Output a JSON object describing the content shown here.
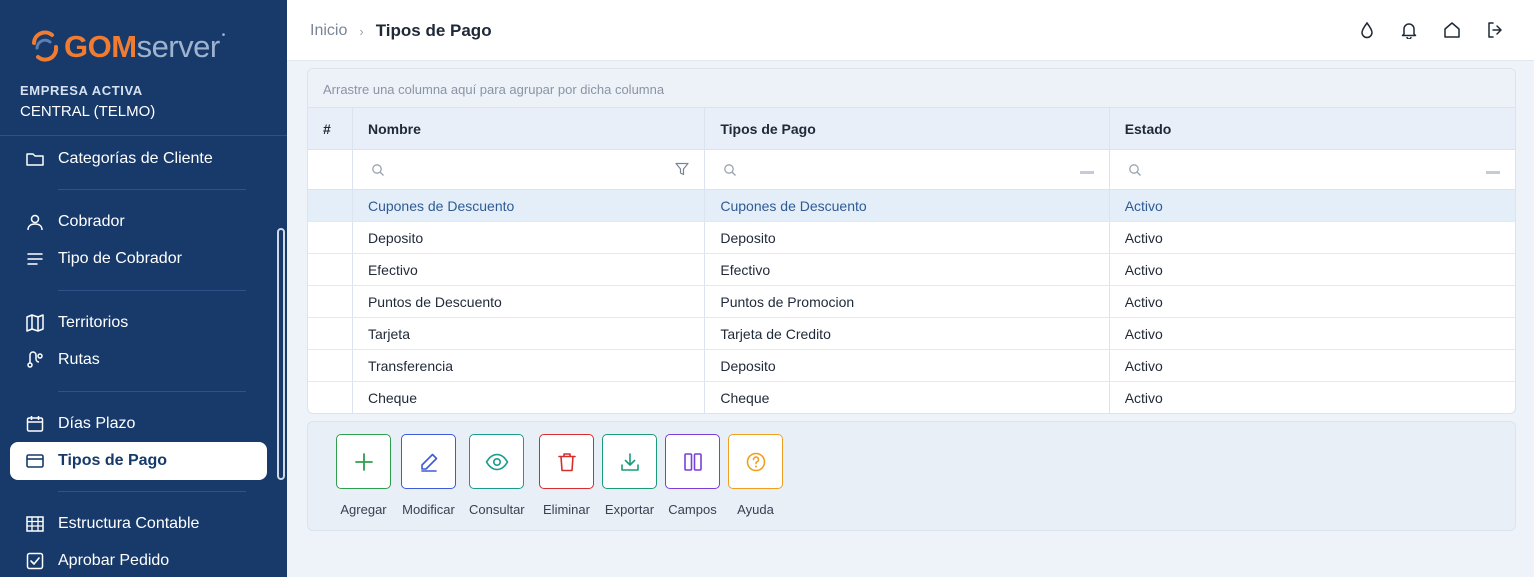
{
  "brand": {
    "gom": "GOM",
    "server": "server",
    "mark": "•"
  },
  "company": {
    "label": "EMPRESA ACTIVA",
    "name": "CENTRAL (TELMO)"
  },
  "sidebar": {
    "items": [
      {
        "label": "Categorías de Cliente",
        "icon": "folder-icon"
      },
      {
        "label": "Cobrador",
        "icon": "user-icon"
      },
      {
        "label": "Tipo de Cobrador",
        "icon": "list-icon"
      },
      {
        "label": "Territorios",
        "icon": "map-icon"
      },
      {
        "label": "Rutas",
        "icon": "route-icon"
      },
      {
        "label": "Días Plazo",
        "icon": "calendar-icon"
      },
      {
        "label": "Tipos de Pago",
        "icon": "credit-card-icon",
        "active": true
      },
      {
        "label": "Estructura Contable",
        "icon": "table-icon"
      },
      {
        "label": "Aprobar Pedido",
        "icon": "check-square-icon"
      }
    ]
  },
  "breadcrumb": {
    "home": "Inicio",
    "separator": "›",
    "current": "Tipos de Pago"
  },
  "header_icons": [
    "theme-drop-icon",
    "bell-icon",
    "home-icon",
    "logout-icon"
  ],
  "grid": {
    "group_hint": "Arrastre una columna aquí para agrupar por dicha columna",
    "columns": [
      "#",
      "Nombre",
      "Tipos de Pago",
      "Estado"
    ],
    "rows": [
      {
        "nombre": "Cupones de Descuento",
        "tipo": "Cupones de Descuento",
        "estado": "Activo",
        "selected": true
      },
      {
        "nombre": "Deposito",
        "tipo": "Deposito",
        "estado": "Activo"
      },
      {
        "nombre": "Efectivo",
        "tipo": "Efectivo",
        "estado": "Activo"
      },
      {
        "nombre": "Puntos de Descuento",
        "tipo": "Puntos de Promocion",
        "estado": "Activo"
      },
      {
        "nombre": "Tarjeta",
        "tipo": "Tarjeta de Credito",
        "estado": "Activo"
      },
      {
        "nombre": "Transferencia",
        "tipo": "Deposito",
        "estado": "Activo"
      },
      {
        "nombre": "Cheque",
        "tipo": "Cheque",
        "estado": "Activo"
      }
    ]
  },
  "toolbar": {
    "buttons": [
      {
        "label": "Agregar",
        "icon": "plus-icon",
        "color": "#2e9e4f"
      },
      {
        "label": "Modificar",
        "icon": "pencil-icon",
        "color": "#3b5bdb"
      },
      {
        "label": "Consultar",
        "icon": "eye-icon",
        "color": "#1a9c8c"
      },
      {
        "label": "Eliminar",
        "icon": "trash-icon",
        "color": "#d62d2d"
      },
      {
        "label": "Exportar",
        "icon": "download-icon",
        "color": "#1a9c7a"
      },
      {
        "label": "Campos",
        "icon": "columns-icon",
        "color": "#7a3fd6"
      },
      {
        "label": "Ayuda",
        "icon": "help-icon",
        "color": "#f0a020"
      }
    ]
  },
  "colors": {
    "sidebar": "#173a6a",
    "accent_orange": "#f07c32",
    "selected_row_text": "#2f5b93"
  }
}
